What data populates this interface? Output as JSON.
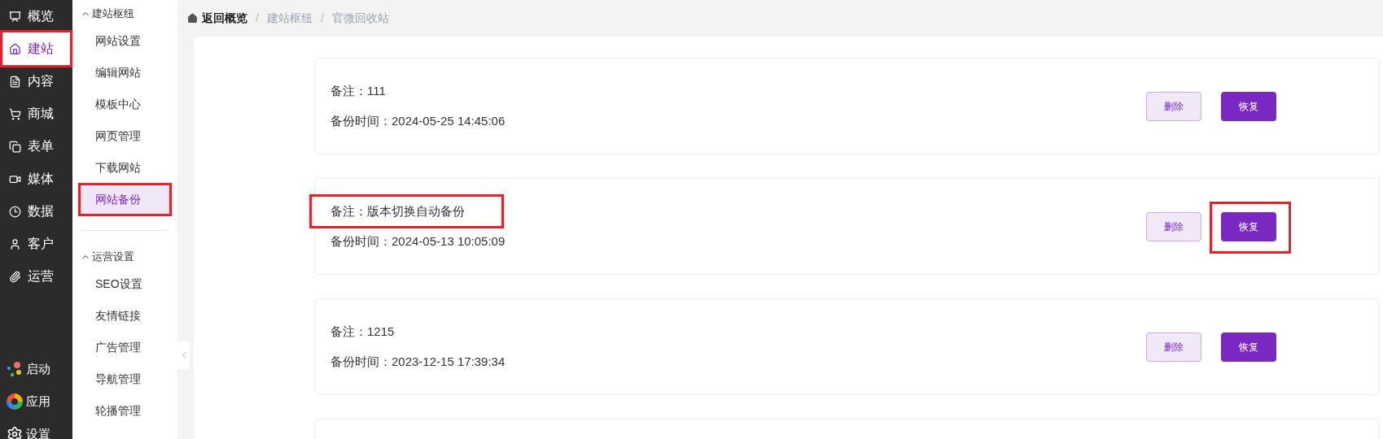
{
  "nav": [
    {
      "label": "概览",
      "selected": false,
      "highlighted": false
    },
    {
      "label": "建站",
      "selected": true,
      "highlighted": true
    },
    {
      "label": "内容",
      "selected": false,
      "highlighted": false
    },
    {
      "label": "商城",
      "selected": false,
      "highlighted": false
    },
    {
      "label": "表单",
      "selected": false,
      "highlighted": false
    },
    {
      "label": "媒体",
      "selected": false,
      "highlighted": false
    },
    {
      "label": "数据",
      "selected": false,
      "highlighted": false
    },
    {
      "label": "客户",
      "selected": false,
      "highlighted": false
    },
    {
      "label": "运营",
      "selected": false,
      "highlighted": false
    }
  ],
  "nav_bottom": [
    {
      "label": "启动"
    },
    {
      "label": "应用"
    },
    {
      "label": "设置"
    }
  ],
  "subnav": [
    {
      "title": "建站枢纽",
      "expanded": true,
      "items": [
        {
          "label": "网站设置",
          "selected": false,
          "highlighted": false
        },
        {
          "label": "编辑网站",
          "selected": false,
          "highlighted": false
        },
        {
          "label": "模板中心",
          "selected": false,
          "highlighted": false
        },
        {
          "label": "网页管理",
          "selected": false,
          "highlighted": false
        },
        {
          "label": "下载网站",
          "selected": false,
          "highlighted": false
        },
        {
          "label": "网站备份",
          "selected": true,
          "highlighted": true
        }
      ]
    },
    {
      "title": "运营设置",
      "expanded": true,
      "items": [
        {
          "label": "SEO设置",
          "selected": false,
          "highlighted": false
        },
        {
          "label": "友情链接",
          "selected": false,
          "highlighted": false
        },
        {
          "label": "广告管理",
          "selected": false,
          "highlighted": false
        },
        {
          "label": "导航管理",
          "selected": false,
          "highlighted": false
        },
        {
          "label": "轮播管理",
          "selected": false,
          "highlighted": false
        }
      ]
    }
  ],
  "breadcrumb": [
    "返回概览",
    "建站枢纽",
    "官微回收站"
  ],
  "breadcrumb_separator": "/",
  "backups": [
    {
      "note": "备注：111",
      "time": "备份时间：2024-05-25 14:45:06",
      "note_highlighted": false,
      "delete": "删除",
      "restore": "恢复",
      "restore_highlighted": false
    },
    {
      "note": "备注：版本切换自动备份",
      "time": "备份时间：2024-05-13 10:05:09",
      "note_highlighted": true,
      "delete": "删除",
      "restore": "恢复",
      "restore_highlighted": true
    },
    {
      "note": "备注：1215",
      "time": "备份时间：2023-12-15 17:39:34",
      "note_highlighted": false,
      "delete": "删除",
      "restore": "恢复",
      "restore_highlighted": false
    }
  ]
}
